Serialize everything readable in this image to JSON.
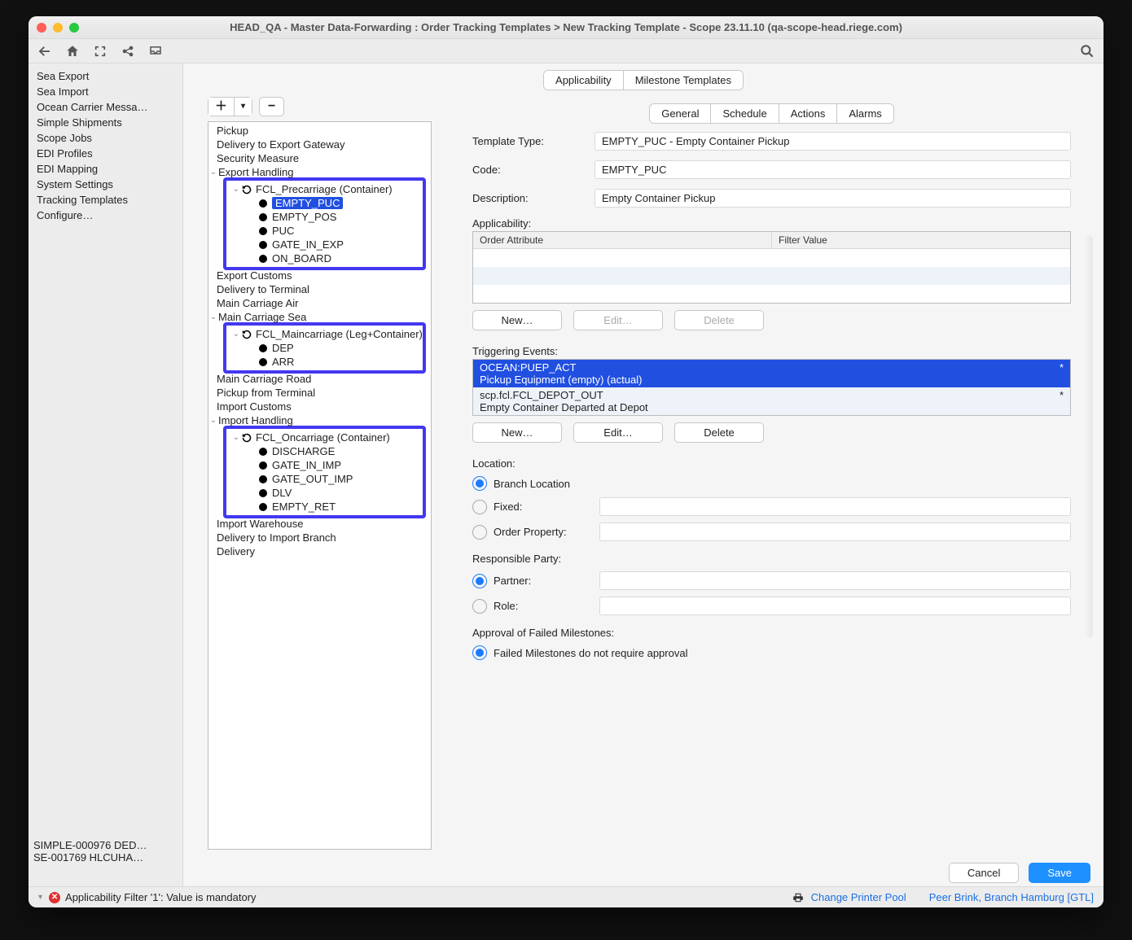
{
  "window_title": "HEAD_QA - Master Data-Forwarding : Order Tracking Templates > New Tracking Template - Scope 23.11.10 (qa-scope-head.riege.com)",
  "sidebar": {
    "items": [
      "Sea Export",
      "Sea Import",
      "Ocean Carrier Messa…",
      "Simple Shipments",
      "Scope Jobs",
      "EDI Profiles",
      "EDI Mapping",
      "System Settings",
      "Tracking Templates",
      "Configure…"
    ]
  },
  "recent": [
    "SIMPLE-000976 DED…",
    "SE-001769 HLCUHA…"
  ],
  "top_tabs": {
    "items": [
      "Applicability",
      "Milestone Templates"
    ],
    "active": 1
  },
  "detail_tabs": {
    "items": [
      "General",
      "Schedule",
      "Actions",
      "Alarms"
    ],
    "active": 0
  },
  "tree": {
    "plain1": [
      "Pickup",
      "Delivery to Export Gateway",
      "Security Measure",
      "Export Handling"
    ],
    "box1": {
      "group": "FCL_Precarriage (Container)",
      "items": [
        "EMPTY_PUC",
        "EMPTY_POS",
        "PUC",
        "GATE_IN_EXP",
        "ON_BOARD"
      ],
      "selected": 0
    },
    "plain2": [
      "Export Customs",
      "Delivery to Terminal",
      "Main Carriage Air",
      "Main Carriage Sea"
    ],
    "box2": {
      "group": "FCL_Maincarriage (Leg+Container)",
      "items": [
        "DEP",
        "ARR"
      ]
    },
    "plain3": [
      "Main Carriage Road",
      "Pickup from Terminal",
      "Import Customs",
      "Import Handling"
    ],
    "box3": {
      "group": "FCL_Oncarriage (Container)",
      "items": [
        "DISCHARGE",
        "GATE_IN_IMP",
        "GATE_OUT_IMP",
        "DLV",
        "EMPTY_RET"
      ]
    },
    "plain4": [
      "Import Warehouse",
      "Delivery to Import Branch",
      "Delivery"
    ]
  },
  "form": {
    "template_type_label": "Template Type:",
    "template_type": "EMPTY_PUC - Empty Container Pickup",
    "code_label": "Code:",
    "code": "EMPTY_PUC",
    "description_label": "Description:",
    "description": "Empty Container Pickup",
    "applicability_label": "Applicability:",
    "applicability_headers": [
      "Order Attribute",
      "Filter Value"
    ],
    "app_btns": {
      "new": "New…",
      "edit": "Edit…",
      "delete": "Delete"
    },
    "trig_label": "Triggering Events:",
    "events": [
      {
        "code": "OCEAN:PUEP_ACT",
        "desc": "Pickup Equipment (empty) (actual)",
        "star": "*",
        "selected": true
      },
      {
        "code": "scp.fcl.FCL_DEPOT_OUT",
        "desc": "Empty Container Departed at Depot",
        "star": "*",
        "selected": false
      }
    ],
    "ev_btns": {
      "new": "New…",
      "edit": "Edit…",
      "delete": "Delete"
    },
    "location_label": "Location:",
    "loc_branch": "Branch Location",
    "loc_fixed": "Fixed:",
    "loc_prop": "Order Property:",
    "resp_label": "Responsible Party:",
    "resp_partner": "Partner:",
    "resp_role": "Role:",
    "approval_label": "Approval of Failed Milestones:",
    "approval_opt": "Failed Milestones do not require approval"
  },
  "footer": {
    "cancel": "Cancel",
    "save": "Save"
  },
  "status": {
    "error": "Applicability Filter '1': Value is mandatory",
    "printer": "Change Printer Pool",
    "user": "Peer Brink, Branch Hamburg [GTL]"
  }
}
